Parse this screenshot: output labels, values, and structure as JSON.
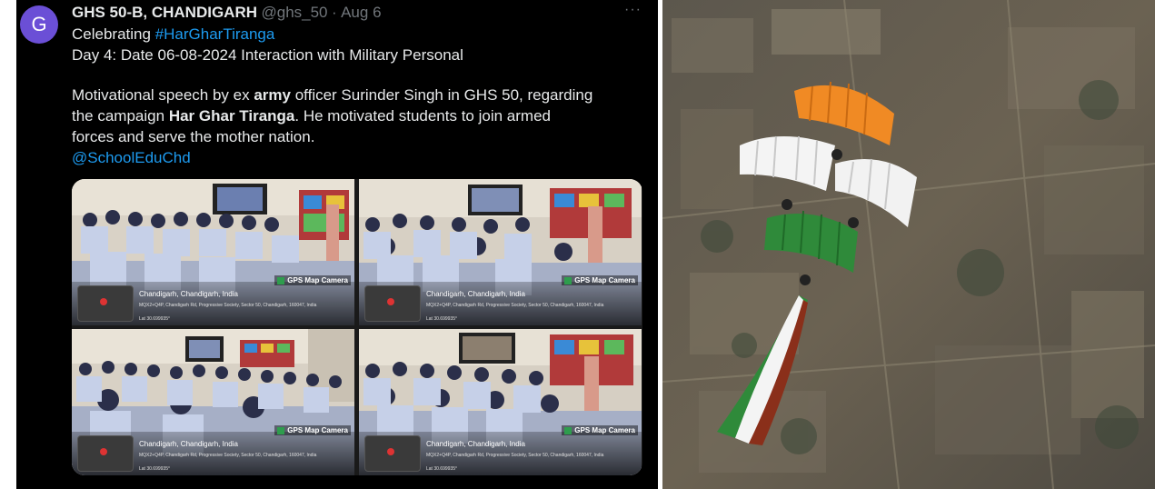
{
  "tweet": {
    "avatar_letter": "G",
    "author": "GHS 50-B, CHANDIGARH",
    "handle": "@ghs_50",
    "separator": "·",
    "date": "Aug 6",
    "more": "···",
    "line1_prefix": "Celebrating",
    "line1_hashtag": "#HarGharTiranga",
    "line2": "Day 4: Date 06-08-2024 Interaction with Military Personal",
    "line3_a": "Motivational speech by ex",
    "line3_b": "army",
    "line3_c": "officer Surinder Singh in GHS 50, regarding",
    "line4_a": "the campaign",
    "line4_b": "Har Ghar Tiranga",
    "line4_c": ". He motivated students to join armed",
    "line5": "forces and serve the mother nation.",
    "mention": "@SchoolEduChd"
  },
  "photos": [
    {
      "city": "Chandigarh, Chandigarh, India",
      "addr": "MQX2+Q4P, Chandigarh Rd, Progressive Society, Sector 50, Chandigarh, 160047, India",
      "lat": "Lat 30.699935°",
      "stamp": "GPS Map Camera"
    },
    {
      "city": "Chandigarh, Chandigarh, India",
      "addr": "MQX2+Q4P, Chandigarh Rd, Progressive Society, Sector 50, Chandigarh, 160047, India",
      "lat": "Lat 30.699935°",
      "stamp": "GPS Map Camera"
    },
    {
      "city": "Chandigarh, Chandigarh, India",
      "addr": "MQX2+Q4P, Chandigarh Rd, Progressive Society, Sector 50, Chandigarh, 160047, India",
      "lat": "Lat 30.699935°",
      "stamp": "GPS Map Camera"
    },
    {
      "city": "Chandigarh, Chandigarh, India",
      "addr": "MQX2+Q4P, Chandigarh Rd, Progressive Society, Sector 50, Chandigarh, 160047, India",
      "lat": "Lat 30.699935°",
      "stamp": "GPS Map Camera"
    }
  ],
  "colors": {
    "tweet_bg": "#000000",
    "text": "#e7e9ea",
    "muted": "#71767b",
    "link": "#1d9bf0",
    "avatar": "#6b4fd6",
    "saffron": "#f08a24",
    "white": "#f4f4f4",
    "green": "#2f8a3a"
  },
  "icons": [
    "more-icon",
    "gps-camera-icon",
    "map-thumbnail-icon"
  ]
}
